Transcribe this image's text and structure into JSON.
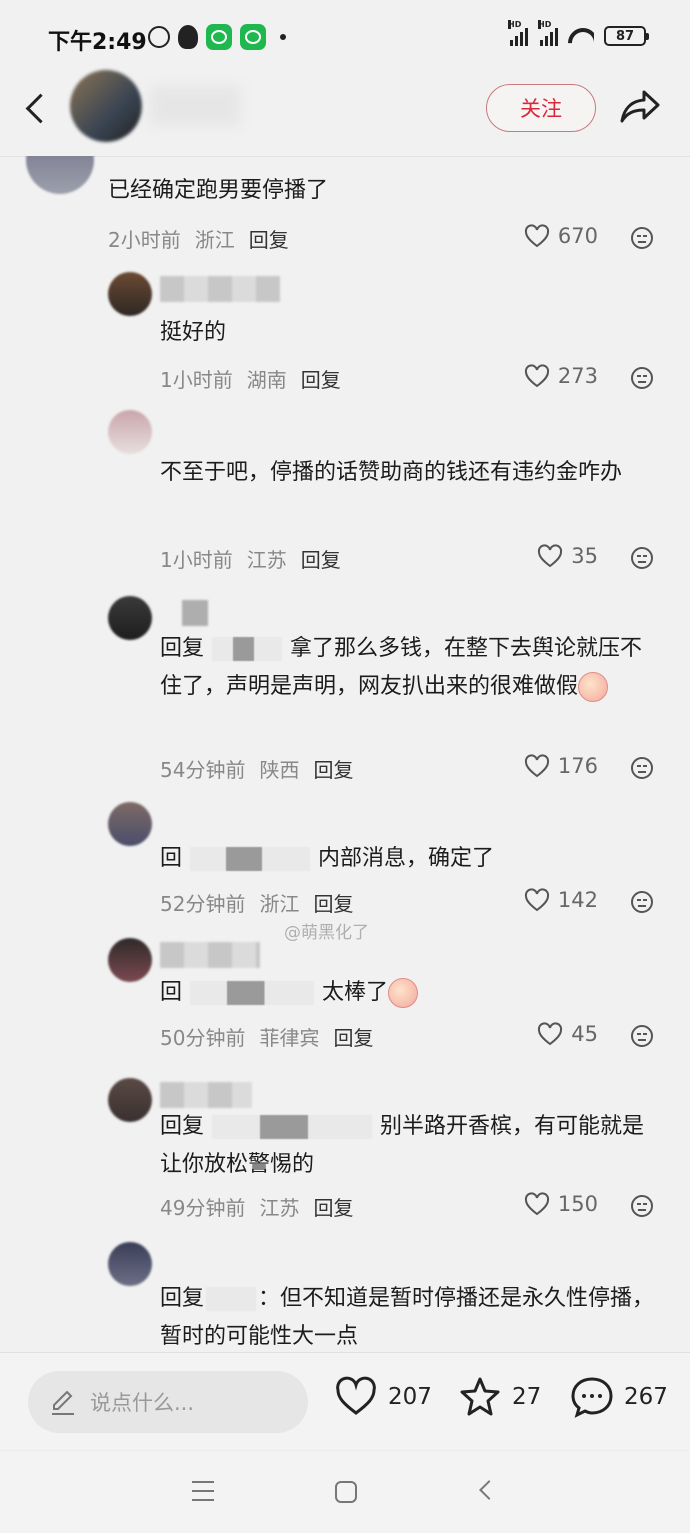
{
  "status": {
    "time": "下午2:49",
    "hd1": "HD",
    "hd2": "HD",
    "battery": "87"
  },
  "header": {
    "follow_label": "关注"
  },
  "comments": [
    {
      "text": "已经确定跑男要停播了",
      "time": "2小时前",
      "location": "浙江",
      "reply": "回复",
      "likes": "670"
    },
    {
      "text": "挺好的",
      "time": "1小时前",
      "location": "湖南",
      "reply": "回复",
      "likes": "273"
    },
    {
      "text": "不至于吧，停播的话赞助商的钱还有违约金咋办",
      "time": "1小时前",
      "location": "江苏",
      "reply": "回复",
      "likes": "35"
    },
    {
      "prefix": "回复",
      "text": "拿了那么多钱，在整下去舆论就压不住了，声明是声明，网友扒出来的很难做假",
      "time": "54分钟前",
      "location": "陕西",
      "reply": "回复",
      "likes": "176"
    },
    {
      "prefix": "回",
      "text": "内部消息，确定了",
      "time": "52分钟前",
      "location": "浙江",
      "reply": "回复",
      "likes": "142"
    },
    {
      "prefix": "回",
      "text": "太棒了",
      "time": "50分钟前",
      "location": "菲律宾",
      "reply": "回复",
      "likes": "45"
    },
    {
      "prefix": "回复",
      "text": "别半路开香槟，有可能就是让你放松警惕的",
      "time": "49分钟前",
      "location": "江苏",
      "reply": "回复",
      "likes": "150"
    },
    {
      "prefix": "回复",
      "text": "：但不知道是暂时停播还是永久性停播，暂时的可能性大一点"
    }
  ],
  "watermark": "@萌黑化了",
  "bottom": {
    "placeholder": "说点什么...",
    "likes": "207",
    "favorites": "27",
    "comments": "267"
  }
}
